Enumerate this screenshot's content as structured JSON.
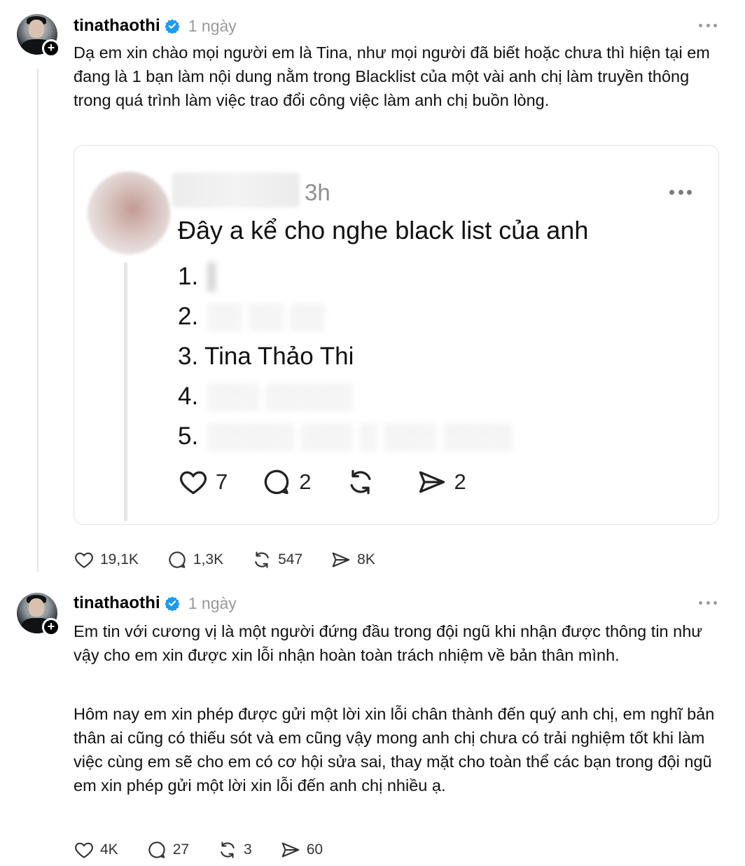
{
  "posts": [
    {
      "username": "tinathaothi",
      "timestamp": "1 ngày",
      "text": "Dạ em xin chào mọi người em là Tina, như mọi người đã biết hoặc chưa thì hiện tại em đang là 1 bạn làm nội dung nằm trong Blacklist của một vài anh chị làm truyền thông trong quá trình làm việc trao đổi công việc làm anh chị buồn lòng.",
      "quoted": {
        "timestamp": "3h",
        "text": "Đây a kể cho nghe black list của anh",
        "list": [
          {
            "num": "1.",
            "label": ""
          },
          {
            "num": "2.",
            "label": ""
          },
          {
            "num": "3.",
            "label": "Tina Thảo Thi"
          },
          {
            "num": "4.",
            "label": ""
          },
          {
            "num": "5.",
            "label": ""
          }
        ],
        "likes": "7",
        "replies": "2",
        "shares": "2"
      },
      "likes": "19,1K",
      "replies": "1,3K",
      "reposts": "547",
      "shares": "8K"
    },
    {
      "username": "tinathaothi",
      "timestamp": "1 ngày",
      "text_p1": "Em tin với cương vị là một người đứng đầu trong đội ngũ khi nhận được thông tin như vậy cho em xin được xin lỗi nhận hoàn toàn trách nhiệm về bản thân mình.",
      "text_p2": "Hôm nay em xin phép được gửi một lời xin lỗi chân thành đến quý anh chị, em nghĩ bản thân ai cũng có thiếu sót và em cũng vậy mong anh chị chưa có trải nghiệm tốt khi làm việc cùng em sẽ cho em có cơ hội sửa sai, thay mặt cho toàn thể các bạn trong đội ngũ em xin phép gửi một lời xin lỗi đến anh chị nhiều ạ.",
      "likes": "4K",
      "replies": "27",
      "reposts": "3",
      "shares": "60"
    }
  ],
  "colors": {
    "verified": "#1d9bf0",
    "muted": "#9a9a9a"
  }
}
